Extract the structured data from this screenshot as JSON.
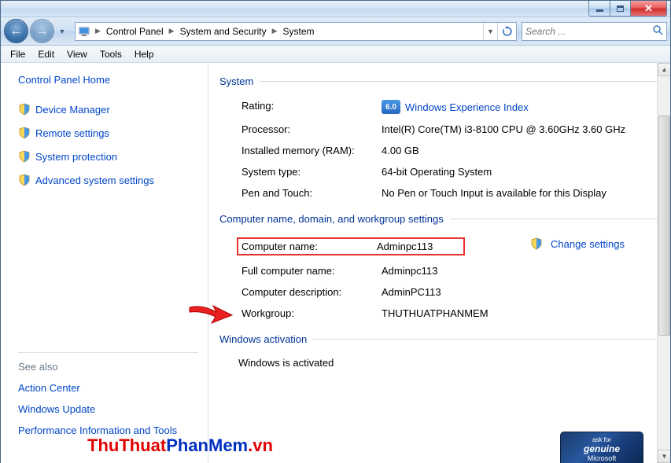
{
  "breadcrumbs": [
    "Control Panel",
    "System and Security",
    "System"
  ],
  "search": {
    "placeholder": "Search ..."
  },
  "menus": [
    "File",
    "Edit",
    "View",
    "Tools",
    "Help"
  ],
  "sidebar": {
    "home": "Control Panel Home",
    "links": [
      "Device Manager",
      "Remote settings",
      "System protection",
      "Advanced system settings"
    ],
    "see_also_title": "See also",
    "see_also": [
      "Action Center",
      "Windows Update",
      "Performance Information and Tools"
    ]
  },
  "sections": {
    "system": {
      "title": "System",
      "rating_label": "Rating:",
      "wei_score": "6.0",
      "wei_text": "Windows Experience Index",
      "processor_label": "Processor:",
      "processor_value": "Intel(R) Core(TM) i3-8100 CPU @ 3.60GHz 3.60 GHz",
      "ram_label": "Installed memory (RAM):",
      "ram_value": "4.00 GB",
      "type_label": "System type:",
      "type_value": "64-bit Operating System",
      "pen_label": "Pen and Touch:",
      "pen_value": "No Pen or Touch Input is available for this Display"
    },
    "computer": {
      "title": "Computer name, domain, and workgroup settings",
      "name_label": "Computer name:",
      "name_value": "Adminpc113",
      "fullname_label": "Full computer name:",
      "fullname_value": "Adminpc113",
      "desc_label": "Computer description:",
      "desc_value": "AdminPC113",
      "workgroup_label": "Workgroup:",
      "workgroup_value": "THUTHUATPHANMEM",
      "change": "Change settings"
    },
    "activation": {
      "title": "Windows activation",
      "status": "Windows is activated"
    }
  },
  "genuine": {
    "line1": "ask for",
    "line2": "genuine",
    "line3": "Microsoft"
  },
  "watermark": {
    "p1": "ThuThuat",
    "p2": "PhanMem",
    "p3": ".vn"
  }
}
